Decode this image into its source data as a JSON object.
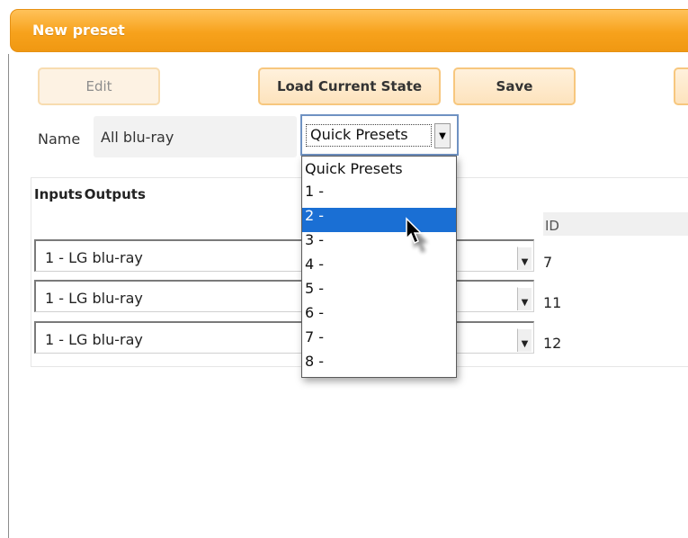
{
  "window": {
    "title": "New preset"
  },
  "toolbar": {
    "edit_label": "Edit",
    "load_label": "Load Current State",
    "save_label": "Save"
  },
  "form": {
    "name_label": "Name",
    "name_value": "All blu-ray"
  },
  "quick_presets": {
    "selected": "Quick Presets",
    "highlighted": "2 -",
    "options": [
      "Quick Presets",
      "1 -",
      "2 -",
      "3 -",
      "4 -",
      "5 -",
      "6 -",
      "7 -",
      "8 -"
    ]
  },
  "tabs": {
    "inputs": "Inputs",
    "outputs": "Outputs"
  },
  "table": {
    "id_header": "ID",
    "rows": [
      {
        "input": "1 - LG blu-ray",
        "id": "7"
      },
      {
        "input": "1 - LG blu-ray",
        "id": "11"
      },
      {
        "input": "1 - LG blu-ray",
        "id": "12"
      }
    ]
  },
  "colors": {
    "title_bar": "#f7a21c",
    "button_border": "#f7c77e",
    "selection": "#1a6fd4"
  }
}
